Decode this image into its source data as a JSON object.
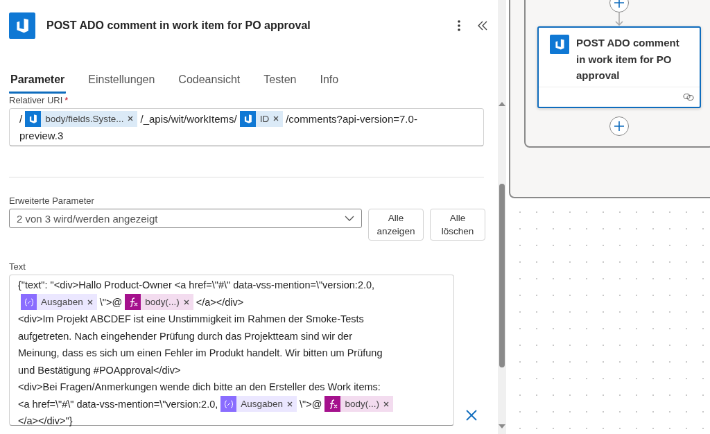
{
  "panel": {
    "title": "POST ADO comment in work item for PO approval"
  },
  "tabs": [
    {
      "label": "Parameter",
      "selected": true
    },
    {
      "label": "Einstellungen",
      "selected": false
    },
    {
      "label": "Codeansicht",
      "selected": false
    },
    {
      "label": "Testen",
      "selected": false
    },
    {
      "label": "Info",
      "selected": false
    }
  ],
  "uri_field": {
    "label": "Relativer URI",
    "required_mark": "*",
    "lines": [
      [
        {
          "kind": "text",
          "text": "/"
        },
        {
          "kind": "connector",
          "label": "body/fields.Syste..."
        },
        {
          "kind": "text",
          "text": "/_apis/wit/workItems/"
        },
        {
          "kind": "connector",
          "label": "ID"
        },
        {
          "kind": "text",
          "text": "/comments?api-version=7.0-"
        }
      ],
      [
        {
          "kind": "text",
          "text": "preview.3"
        }
      ]
    ]
  },
  "advanced": {
    "label": "Erweiterte Parameter",
    "value": "2 von 3 wird/werden angezeigt",
    "buttons": [
      "Alle anzeigen",
      "Alle löschen"
    ]
  },
  "text_field": {
    "label": "Text",
    "lines": [
      [
        {
          "kind": "text",
          "text": "{\"text\": \"<div>Hallo Product-Owner <a href=\\\"#\\\" data-vss-mention=\\\"version:2.0,"
        }
      ],
      [
        {
          "kind": "variable",
          "label": "Ausgaben"
        },
        {
          "kind": "text",
          "text": "\\\">@"
        },
        {
          "kind": "function",
          "label": "body(...)"
        },
        {
          "kind": "text",
          "text": "</a></div>"
        }
      ],
      [
        {
          "kind": "text",
          "text": "<div>Im Projekt ABCDEF ist eine Unstimmigkeit im Rahmen der Smoke-Tests"
        }
      ],
      [
        {
          "kind": "text",
          "text": "aufgetreten. Nach eingehender Prüfung durch das Projektteam sind wir der"
        }
      ],
      [
        {
          "kind": "text",
          "text": "Meinung, dass es sich um einen Fehler im Produkt handelt. Wir bitten um Prüfung"
        }
      ],
      [
        {
          "kind": "text",
          "text": "und Bestätigung #POApproval</div>"
        }
      ],
      [
        {
          "kind": "text",
          "text": "<div>Bei Fragen/Anmerkungen wende dich bitte an den Ersteller des Work items:"
        }
      ],
      [
        {
          "kind": "text",
          "text": "<a href=\\\"#\\\" data-vss-mention=\\\"version:2.0,"
        },
        {
          "kind": "variable",
          "label": "Ausgaben"
        },
        {
          "kind": "text",
          "text": "\\\">@"
        },
        {
          "kind": "function",
          "label": "body(...)"
        }
      ],
      [
        {
          "kind": "text",
          "text": "</a></div>\"}"
        }
      ]
    ]
  },
  "canvas": {
    "card": {
      "title": "POST ADO comment in work item for PO approval",
      "selected": true
    }
  }
}
